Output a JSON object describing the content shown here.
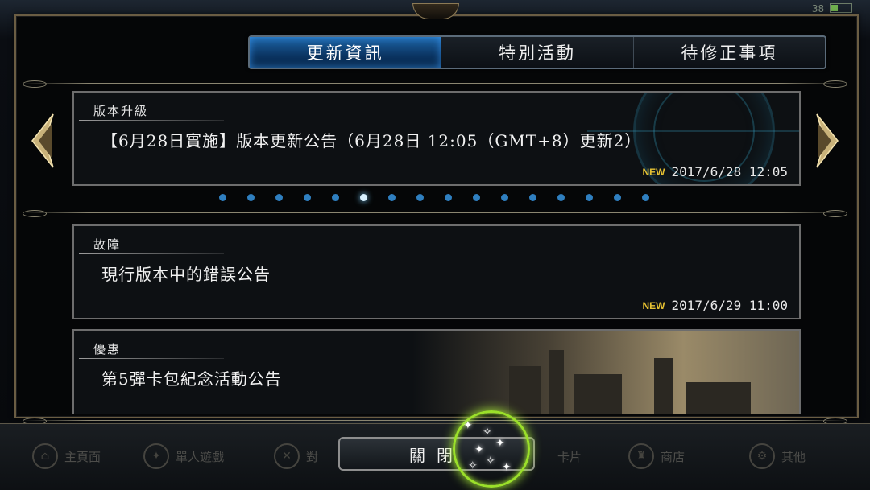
{
  "status": {
    "battery_text": "38"
  },
  "tabs": [
    {
      "label": "更新資訊",
      "active": true
    },
    {
      "label": "特別活動",
      "active": false
    },
    {
      "label": "待修正事項",
      "active": false
    }
  ],
  "featured": {
    "category": "版本升級",
    "title": "【6月28日實施】版本更新公告（6月28日 12:05（GMT+8）更新2）",
    "badge": "NEW",
    "date": "2017/6/28 12:05"
  },
  "pager": {
    "count": 16,
    "active_index": 5
  },
  "news": [
    {
      "category": "故障",
      "title": "現行版本中的錯誤公告",
      "badge": "NEW",
      "date": "2017/6/29 11:00"
    },
    {
      "category": "優惠",
      "title": "第5彈卡包紀念活動公告"
    }
  ],
  "bottom_nav": [
    {
      "label": "主頁面",
      "icon": "home-icon"
    },
    {
      "label": "單人遊戲",
      "icon": "solo-icon"
    },
    {
      "label": "對",
      "icon": "swords-icon"
    },
    {
      "label": "卡片",
      "icon": "card-icon"
    },
    {
      "label": "商店",
      "icon": "shop-icon"
    },
    {
      "label": "其他",
      "icon": "other-icon"
    }
  ],
  "close_label": "關閉",
  "colors": {
    "accent": "#1e66a8",
    "new_badge": "#e7c232",
    "frame": "#6b5d43",
    "spark": "#9be02a"
  }
}
